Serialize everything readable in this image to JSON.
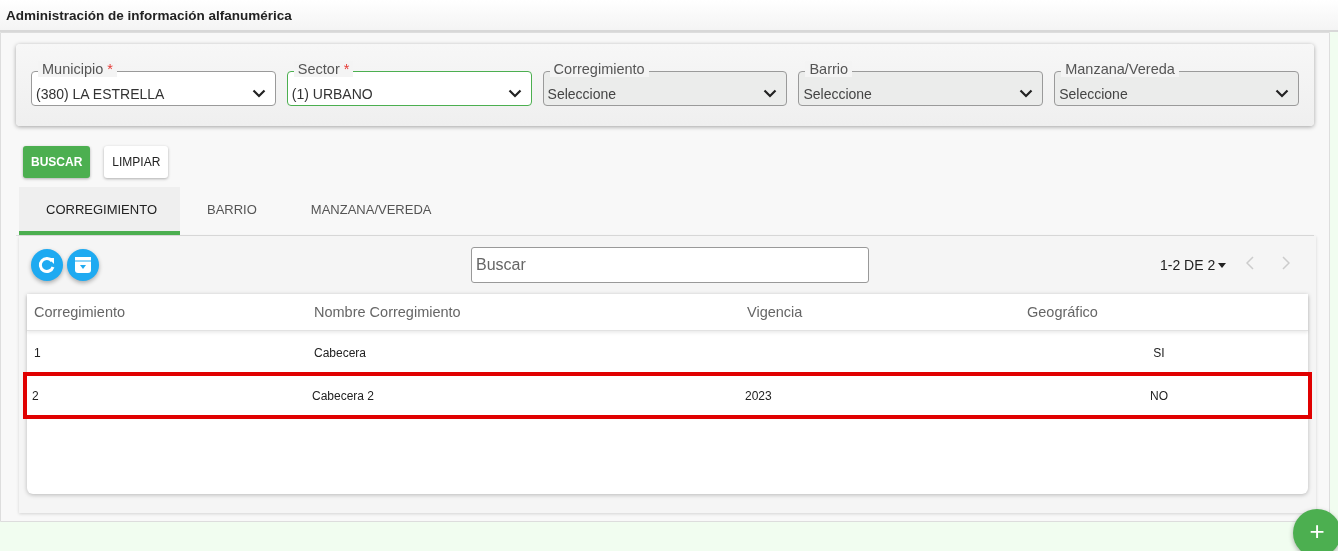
{
  "header": {
    "title": "Administración de información alfanumérica"
  },
  "filters": [
    {
      "label": "Municipio",
      "required": true,
      "value": "(380) LA ESTRELLA",
      "disabled": false,
      "focused": false
    },
    {
      "label": "Sector",
      "required": true,
      "value": "(1) URBANO",
      "disabled": false,
      "focused": true
    },
    {
      "label": "Corregimiento",
      "required": false,
      "value": "Seleccione",
      "disabled": true,
      "focused": false
    },
    {
      "label": "Barrio",
      "required": false,
      "value": "Seleccione",
      "disabled": true,
      "focused": false
    },
    {
      "label": "Manzana/Vereda",
      "required": false,
      "value": "Seleccione",
      "disabled": true,
      "focused": false
    }
  ],
  "required_mark": "*",
  "buttons": [
    {
      "label": "BUSCAR",
      "kind": "primary"
    },
    {
      "label": "LIMPIAR",
      "kind": "plain"
    }
  ],
  "tabs": [
    {
      "label": "CORREGIMIENTO",
      "selected": true
    },
    {
      "label": "BARRIO",
      "selected": false
    },
    {
      "label": "MANZANA/VEREDA",
      "selected": false
    }
  ],
  "table": {
    "search": {
      "placeholder": "Buscar"
    },
    "pagination": "1-2 DE 2",
    "columns": [
      "Corregimiento",
      "Nombre Corregimiento",
      "Vigencia",
      "Geográfico"
    ],
    "rows": [
      {
        "cells": [
          "1",
          "Cabecera",
          "",
          "SI"
        ],
        "highlighted": false
      },
      {
        "cells": [
          "2",
          "Cabecera 2",
          "2023",
          "NO"
        ],
        "highlighted": true
      }
    ]
  },
  "fab": {
    "label": "+"
  }
}
